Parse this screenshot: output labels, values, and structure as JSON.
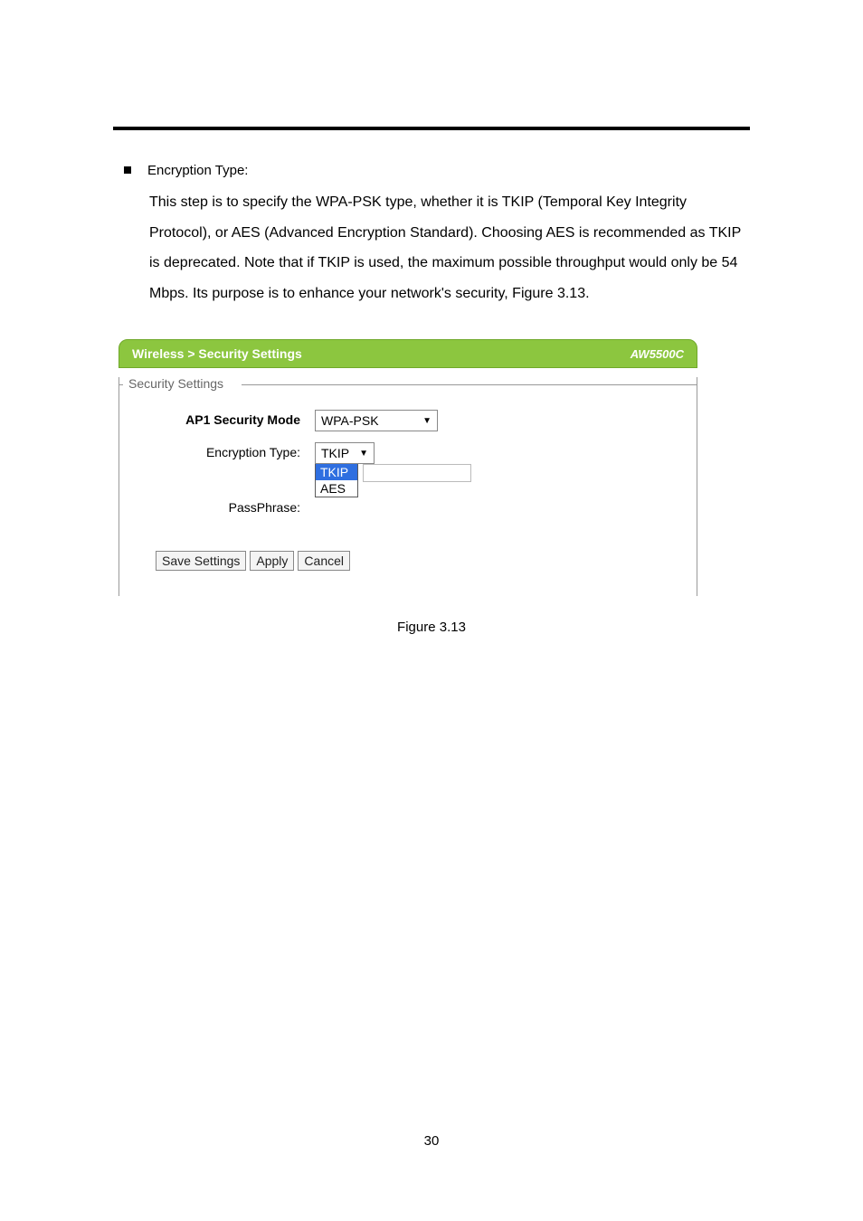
{
  "doc": {
    "bullet_heading": "Encryption Type:",
    "body_para": "This step is to specify the WPA-PSK type, whether it is TKIP (Temporal Key Integrity Protocol), or AES (Advanced Encryption Standard). Choosing AES is recommended as TKIP is deprecated. Note that if TKIP is used, the maximum possible throughput would only be 54 Mbps. Its purpose is to enhance your network's security, Figure 3.13.",
    "figure_caption": "Figure 3.13",
    "page_number": "30"
  },
  "ui": {
    "header_left": "Wireless > Security Settings",
    "header_right": "AW5500C",
    "legend": "Security Settings",
    "rows": {
      "mode_label": "AP1 Security Mode",
      "mode_value": "WPA-PSK",
      "enc_label": "Encryption Type:",
      "enc_value": "TKIP",
      "enc_opt_selected": "TKIP",
      "enc_opt_other": "AES",
      "pass_label": "PassPhrase:"
    },
    "buttons": {
      "save": "Save Settings",
      "apply": "Apply",
      "cancel": "Cancel"
    }
  }
}
